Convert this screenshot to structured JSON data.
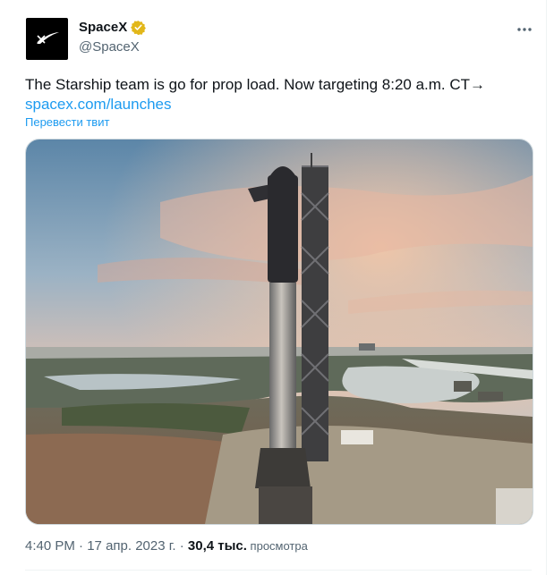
{
  "author": {
    "name": "SpaceX",
    "handle": "@SpaceX",
    "verified": true,
    "avatar_icon": "spacex-logo-icon",
    "badge_color": "#e2b719"
  },
  "more_icon": "more-dots-icon",
  "tweet": {
    "text": "The Starship team is go for prop load. Now targeting 8:20 a.m. CT→",
    "link": "spacex.com/launches",
    "translate": "Перевести твит"
  },
  "media": {
    "icon": "starship-launch-photo"
  },
  "meta": {
    "time": "4:40 PM",
    "sep1": " · ",
    "date": "17 апр. 2023 г.",
    "sep2": " · ",
    "views": "30,4 тыс.",
    "views_label": " просмотра"
  },
  "colors": {
    "link": "#1d9bf0",
    "secondary_text": "#536471",
    "primary_text": "#0f1419"
  }
}
